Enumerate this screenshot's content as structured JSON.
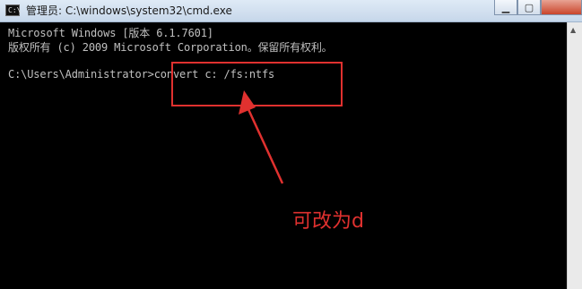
{
  "window": {
    "title": "管理员: C:\\windows\\system32\\cmd.exe",
    "icon": "cmd-icon",
    "icon_text": "C:\\"
  },
  "console": {
    "lines": [
      "Microsoft Windows [版本 6.1.7601]",
      "版权所有 (c) 2009 Microsoft Corporation。保留所有权利。",
      "",
      "C:\\Users\\Administrator>convert c: /fs:ntfs"
    ]
  },
  "annotation": {
    "text": "可改为d",
    "color": "#e0312f"
  }
}
